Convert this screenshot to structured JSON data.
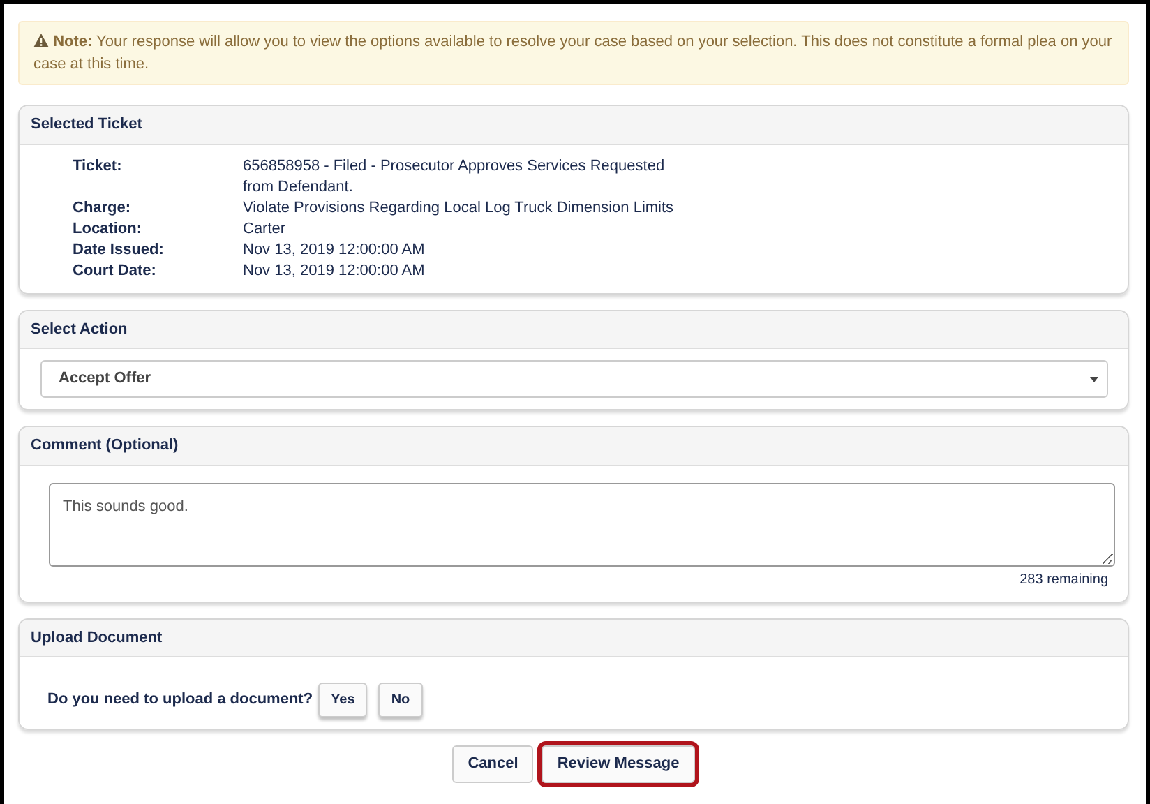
{
  "note": {
    "label": "Note:",
    "text": "Your response will allow you to view the options available to resolve your case based on your selection. This does not constitute a formal plea on your case at this time."
  },
  "selected_ticket": {
    "title": "Selected Ticket",
    "fields": [
      {
        "label": "Ticket:",
        "value": "656858958 - Filed - Prosecutor Approves Services Requested from Defendant."
      },
      {
        "label": "Charge:",
        "value": "Violate Provisions Regarding Local Log Truck Dimension Limits"
      },
      {
        "label": "Location:",
        "value": "Carter"
      },
      {
        "label": "Date Issued:",
        "value": "Nov 13, 2019 12:00:00 AM"
      },
      {
        "label": "Court Date:",
        "value": "Nov 13, 2019 12:00:00 AM"
      }
    ]
  },
  "select_action": {
    "title": "Select Action",
    "value": "Accept Offer"
  },
  "comment": {
    "title": "Comment (Optional)",
    "value": "This sounds good.",
    "remaining": "283 remaining"
  },
  "upload": {
    "title": "Upload Document",
    "question": "Do you need to upload a document?",
    "buttons": [
      "Yes",
      "No"
    ]
  },
  "actions": [
    {
      "label": "Cancel",
      "highlighted": false
    },
    {
      "label": "Review Message",
      "highlighted": true
    }
  ]
}
